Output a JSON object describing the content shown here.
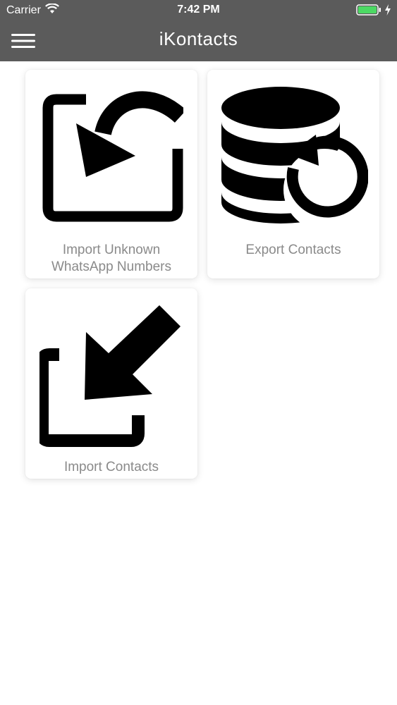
{
  "status_bar": {
    "carrier": "Carrier",
    "time": "7:42 PM",
    "wifi_icon": "wifi-icon",
    "battery_icon": "battery-icon",
    "charging_icon": "charging-bolt-icon",
    "battery_color": "#4cd964"
  },
  "nav_bar": {
    "title": "iKontacts",
    "menu_icon": "hamburger-menu-icon",
    "background": "#5b5b5b"
  },
  "cards": [
    {
      "label_line1": "Import Unknown",
      "label_line2": "WhatsApp Numbers",
      "icon": "import-arrow-box-icon"
    },
    {
      "label_line1": "Export Contacts",
      "icon": "database-refresh-icon"
    },
    {
      "label_line1": "Import Contacts",
      "icon": "import-down-left-arrow-icon"
    }
  ]
}
